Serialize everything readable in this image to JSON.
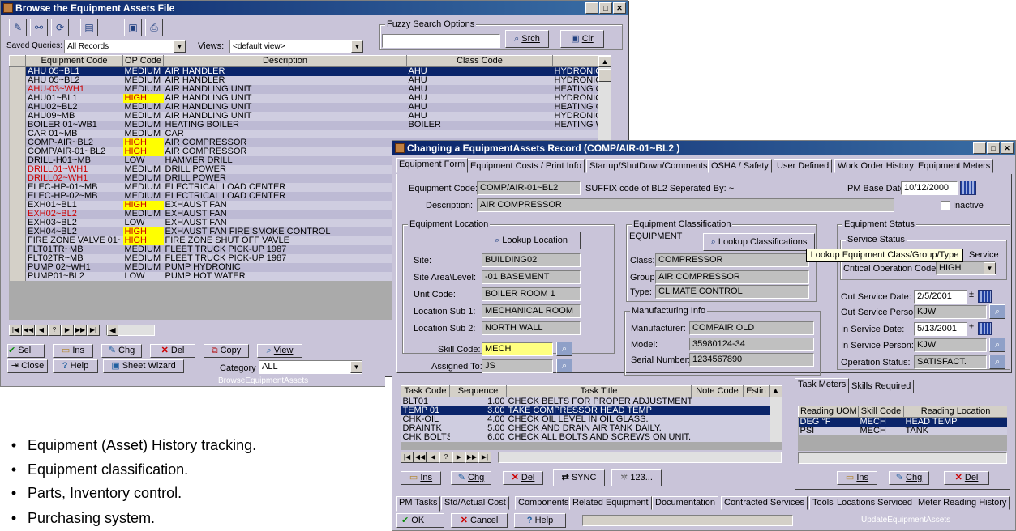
{
  "browse": {
    "title": "Browse the Equipment Assets File",
    "saved_queries_label": "Saved Queries:",
    "saved_queries_value": "All Records",
    "views_label": "Views:",
    "views_value": "<default view>",
    "fuzzy_label": "Fuzzy Search Options",
    "srch_label": "Srch",
    "clr_label": "Clr",
    "columns": [
      "Equipment Code",
      "OP Code",
      "Description",
      "Class Code",
      ""
    ],
    "rows": [
      {
        "code": "AHU 05~BL1",
        "op": "MEDIUM",
        "desc": "AIR HANDLER",
        "cls": "AHU",
        "x": "HYDRONIC",
        "sel": true
      },
      {
        "code": "AHU 05~BL2",
        "op": "MEDIUM",
        "desc": "AIR HANDLER",
        "cls": "AHU",
        "x": "HYDRONIC"
      },
      {
        "code": "AHU-03~WH1",
        "op": "MEDIUM",
        "desc": "AIR HANDLING UNIT",
        "cls": "AHU",
        "x": "HEATING OI",
        "red": true
      },
      {
        "code": "AHU01~BL1",
        "op": "HIGH",
        "desc": "AIR HANDLING UNIT",
        "cls": "AHU",
        "x": "HYDRONIC",
        "hi": true
      },
      {
        "code": "AHU02~BL2",
        "op": "MEDIUM",
        "desc": "AIR HANDLING UNIT",
        "cls": "AHU",
        "x": "HEATING OI"
      },
      {
        "code": "AHU09~MB",
        "op": "MEDIUM",
        "desc": "AIR HANDLING UNIT",
        "cls": "AHU",
        "x": "HYDRONIC"
      },
      {
        "code": "BOILER 01~WB1",
        "op": "MEDIUM",
        "desc": "HEATING BOILER",
        "cls": "BOILER",
        "x": "HEATING W"
      },
      {
        "code": "CAR 01~MB",
        "op": "MEDIUM",
        "desc": "CAR",
        "cls": "",
        "x": ""
      },
      {
        "code": "COMP-AIR~BL2",
        "op": "HIGH",
        "desc": "AIR COMPRESSOR",
        "cls": "",
        "x": "",
        "hi": true
      },
      {
        "code": "COMP/AIR-01~BL2",
        "op": "HIGH",
        "desc": "AIR COMPRESSOR",
        "cls": "",
        "x": "",
        "hi": true
      },
      {
        "code": "DRILL-H01~MB",
        "op": "LOW",
        "desc": "HAMMER DRILL",
        "cls": "",
        "x": ""
      },
      {
        "code": "DRILL01~WH1",
        "op": "MEDIUM",
        "desc": "DRILL POWER",
        "cls": "",
        "x": "",
        "red": true
      },
      {
        "code": "DRILL02~WH1",
        "op": "MEDIUM",
        "desc": "DRILL POWER",
        "cls": "",
        "x": "",
        "red": true
      },
      {
        "code": "ELEC-HP-01~MB",
        "op": "MEDIUM",
        "desc": "ELECTRICAL LOAD CENTER",
        "cls": "",
        "x": ""
      },
      {
        "code": "ELEC-HP-02~MB",
        "op": "MEDIUM",
        "desc": "ELECTRICAL LOAD CENTER",
        "cls": "",
        "x": ""
      },
      {
        "code": "EXH01~BL1",
        "op": "HIGH",
        "desc": "EXHAUST FAN",
        "cls": "",
        "x": "",
        "hi": true
      },
      {
        "code": "EXH02~BL2",
        "op": "MEDIUM",
        "desc": "EXHAUST FAN",
        "cls": "",
        "x": "",
        "red": true
      },
      {
        "code": "EXH03~BL2",
        "op": "LOW",
        "desc": "EXHAUST FAN",
        "cls": "",
        "x": ""
      },
      {
        "code": "EXH04~BL2",
        "op": "HIGH",
        "desc": "EXHAUST FAN FIRE SMOKE CONTROL",
        "cls": "",
        "x": "",
        "hi": true
      },
      {
        "code": "FIRE ZONE VALVE 01~",
        "op": "HIGH",
        "desc": "FIRE ZONE SHUT OFF VAVLE",
        "cls": "",
        "x": "",
        "hi": true
      },
      {
        "code": "FLT01TR~MB",
        "op": "MEDIUM",
        "desc": "FLEET TRUCK PICK-UP 1987",
        "cls": "",
        "x": ""
      },
      {
        "code": "FLT02TR~MB",
        "op": "MEDIUM",
        "desc": "FLEET TRUCK PICK-UP 1987",
        "cls": "",
        "x": ""
      },
      {
        "code": "PUMP 02~WH1",
        "op": "MEDIUM",
        "desc": "PUMP HYDRONIC",
        "cls": "",
        "x": ""
      },
      {
        "code": "PUMP01~BL2",
        "op": "LOW",
        "desc": "PUMP HOT WATER",
        "cls": "",
        "x": ""
      }
    ],
    "nav_buttons": [
      "|◀",
      "◀◀",
      "◀",
      "?",
      "▶",
      "▶▶",
      "▶|"
    ],
    "actions": {
      "sel": "Sel",
      "ins": "Ins",
      "chg": "Chg",
      "del": "Del",
      "copy": "Copy",
      "view": "View",
      "close": "Close",
      "help": "Help",
      "sheet_wizard": "Sheet Wizard"
    },
    "category_label": "Category",
    "category_value": "ALL",
    "status_name": "BrowseEquipmentAssets"
  },
  "change": {
    "title": "Changing a EquipmentAssets Record  (COMP/AIR-01~BL2   )",
    "tabs": [
      "Equipment Form",
      "Equipment Costs / Print Info",
      "Startup/ShutDown/Comments",
      "OSHA / Safety",
      "User Defined",
      "Work Order History",
      "Equipment Meters"
    ],
    "equipment_code_label": "Equipment Code:",
    "equipment_code_value": "COMP/AIR-01~BL2",
    "suffix_text": "SUFFIX code of BL2 Seperated By: ~",
    "pm_base_date_label": "PM Base Date:",
    "pm_base_date_value": "10/12/2000",
    "description_label": "Description:",
    "description_value": "AIR COMPRESSOR",
    "inactive_label": "Inactive",
    "location": {
      "group_label": "Equipment Location",
      "lookup_label": "Lookup Location",
      "site_label": "Site:",
      "site_value": "BUILDING02",
      "area_label": "Site Area\\Level:",
      "area_value": "-01 BASEMENT",
      "unit_label": "Unit Code:",
      "unit_value": "BOILER ROOM 1",
      "sub1_label": "Location Sub 1:",
      "sub1_value": "MECHANICAL ROOM",
      "sub2_label": "Location Sub 2:",
      "sub2_value": "NORTH WALL"
    },
    "skill_code_label": "Skill Code:",
    "skill_code_value": "MECH",
    "assigned_to_label": "Assigned To:",
    "assigned_to_value": "JS",
    "classification": {
      "group_label": "Equipment Classification",
      "type_text": "EQUIPMENT",
      "lookup_label": "Lookup Classifications",
      "class_label": "Class:",
      "class_value": "COMPRESSOR",
      "group_field_label": "Group:",
      "group_value": "AIR COMPRESSOR",
      "type_label": "Type:",
      "type_value": "CLIMATE CONTROL"
    },
    "tooltip": "Lookup Equipment Class/Group/Type",
    "manufacturing": {
      "group_label": "Manufacturing Info",
      "manufacturer_label": "Manufacturer:",
      "manufacturer_value": "COMPAIR OLD",
      "model_label": "Model:",
      "model_value": "35980124-34",
      "serial_label": "Serial Number:",
      "serial_value": "1234567890"
    },
    "status": {
      "group_label": "Equipment Status",
      "service_status_label": "Service Status",
      "service_text": "Service",
      "critical_label": "Critical Operation Code:",
      "critical_value": "HIGH",
      "out_date_label": "Out Service Date:",
      "out_date_value": "2/5/2001",
      "out_person_label": "Out Service Person:",
      "out_person_value": "KJW",
      "in_date_label": "In Service Date:",
      "in_date_value": "5/13/2001",
      "in_person_label": "In Service Person:",
      "in_person_value": "KJW",
      "op_status_label": "Operation Status:",
      "op_status_value": "SATISFACT."
    },
    "tasks": {
      "columns": [
        "Task Code",
        "Sequence",
        "Task Title",
        "Note Code",
        "Estin"
      ],
      "rows": [
        {
          "code": "BLT01",
          "seq": "1.00",
          "title": "CHECK BELTS FOR PROPER ADJUSTMENT"
        },
        {
          "code": "TEMP 01",
          "seq": "3.00",
          "title": "TAKE COMPRESSOR HEAD TEMP",
          "sel": true
        },
        {
          "code": "CHK-OIL",
          "seq": "4.00",
          "title": "CHECK OIL LEVEL IN OIL GLASS."
        },
        {
          "code": "DRAINTK",
          "seq": "5.00",
          "title": "CHECK AND DRAIN AIR TANK DAILY."
        },
        {
          "code": "CHK BOLTS",
          "seq": "6.00",
          "title": "CHECK ALL BOLTS AND SCREWS ON UNIT."
        }
      ],
      "ins": "Ins",
      "chg": "Chg",
      "del": "Del",
      "sync": "SYNC",
      "num": "123..."
    },
    "meters": {
      "tabs": [
        "Task Meters",
        "Skills Required"
      ],
      "columns": [
        "Reading UOM",
        "Skill Code",
        "Reading Location"
      ],
      "rows": [
        {
          "uom": "DEG °F",
          "skill": "MECH",
          "loc": "HEAD TEMP",
          "sel": true
        },
        {
          "uom": "PSI",
          "skill": "MECH",
          "loc": "TANK"
        }
      ],
      "ins": "Ins",
      "chg": "Chg",
      "del": "Del"
    },
    "bottom_tabs": [
      "PM Tasks",
      "Std/Actual Cost",
      "Components",
      "Related Equipment",
      "Documentation",
      "Contracted Services",
      "Tools",
      "Locations Serviced",
      "Meter Reading History"
    ],
    "ok_label": "OK",
    "cancel_label": "Cancel",
    "help_label": "Help",
    "status_name": "UpdateEquipmentAssets"
  },
  "bullets": [
    "Equipment (Asset) History tracking.",
    "Equipment classification.",
    "Parts, Inventory control.",
    "Purchasing system."
  ]
}
